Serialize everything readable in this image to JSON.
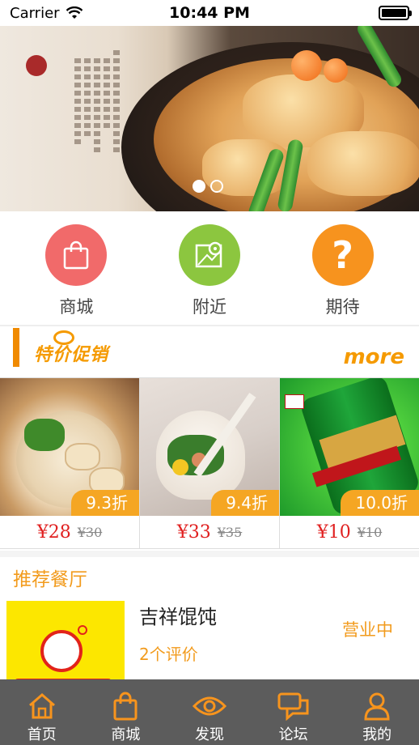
{
  "status_bar": {
    "carrier": "Carrier",
    "time": "10:44 PM"
  },
  "banner": {
    "slide_count": 2,
    "active_slide": 1
  },
  "categories": [
    {
      "label": "商城",
      "icon": "shopping-bag-icon",
      "color": "#f16a6a"
    },
    {
      "label": "附近",
      "icon": "map-pin-icon",
      "color": "#8cc63f"
    },
    {
      "label": "期待",
      "icon": "question-icon",
      "color": "#f7931e"
    }
  ],
  "promo": {
    "title": "特价促销",
    "more_label": "more"
  },
  "products": [
    {
      "discount": "9.3折",
      "price": "¥28",
      "original_price": "¥30"
    },
    {
      "discount": "9.4折",
      "price": "¥33",
      "original_price": "¥35"
    },
    {
      "discount": "10.0折",
      "price": "¥10",
      "original_price": "¥10"
    }
  ],
  "recommend": {
    "title": "推荐餐厅",
    "restaurant": {
      "name": "吉祥馄饨",
      "reviews": "2个评价",
      "status": "营业中"
    }
  },
  "tabbar": [
    {
      "label": "首页",
      "icon": "home-icon"
    },
    {
      "label": "商城",
      "icon": "shopping-bag-icon"
    },
    {
      "label": "发现",
      "icon": "eye-icon"
    },
    {
      "label": "论坛",
      "icon": "chat-icon"
    },
    {
      "label": "我的",
      "icon": "user-icon"
    }
  ],
  "colors": {
    "accent": "#f29b1d",
    "price": "#e02020",
    "tabbar": "#5c5c5c"
  }
}
